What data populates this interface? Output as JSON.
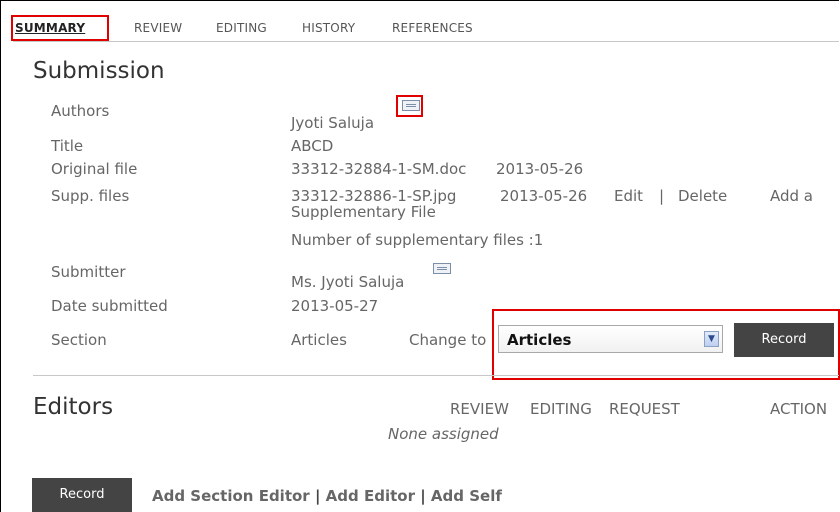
{
  "tabs": [
    {
      "label": "SUMMARY",
      "active": true
    },
    {
      "label": "REVIEW"
    },
    {
      "label": "EDITING"
    },
    {
      "label": "HISTORY"
    },
    {
      "label": "REFERENCES"
    }
  ],
  "submission": {
    "heading": "Submission",
    "authors_label": "Authors",
    "authors_value": "Jyoti Saluja",
    "title_label": "Title",
    "title_value": "ABCD",
    "original_file_label": "Original file",
    "original_file_name": "33312-32884-1-SM.doc",
    "original_file_date": "2013-05-26",
    "supp_files_label": "Supp. files",
    "supp_file_name": "33312-32886-1-SP.jpg",
    "supp_file_date": "2013-05-26",
    "edit_link": "Edit",
    "link_separator": "|",
    "delete_link": "Delete",
    "add_supp_line1": "Add a",
    "add_supp_line2": "Supplementary File",
    "supp_count_text": "Number of supplementary files :1",
    "submitter_label": "Submitter",
    "submitter_value": "Ms. Jyoti Saluja",
    "date_submitted_label": "Date submitted",
    "date_submitted_value": "2013-05-27",
    "section_label": "Section",
    "section_value": "Articles",
    "change_to_label": "Change to",
    "section_select_value": "Articles",
    "record_button": "Record"
  },
  "editors": {
    "heading": "Editors",
    "columns": [
      "REVIEW",
      "EDITING",
      "REQUEST",
      "ACTION"
    ],
    "empty_text": "None assigned",
    "record_button": "Record",
    "add_section_editor": "Add Section Editor",
    "add_editor": "Add Editor",
    "add_self": "Add Self",
    "separator": "|"
  },
  "colors": {
    "highlight_box": "#e00000",
    "button_bg": "#444444"
  },
  "icons": {
    "author_email": "envelope-icon",
    "submitter_email": "envelope-icon",
    "select_arrow": "chevron-down-icon"
  }
}
